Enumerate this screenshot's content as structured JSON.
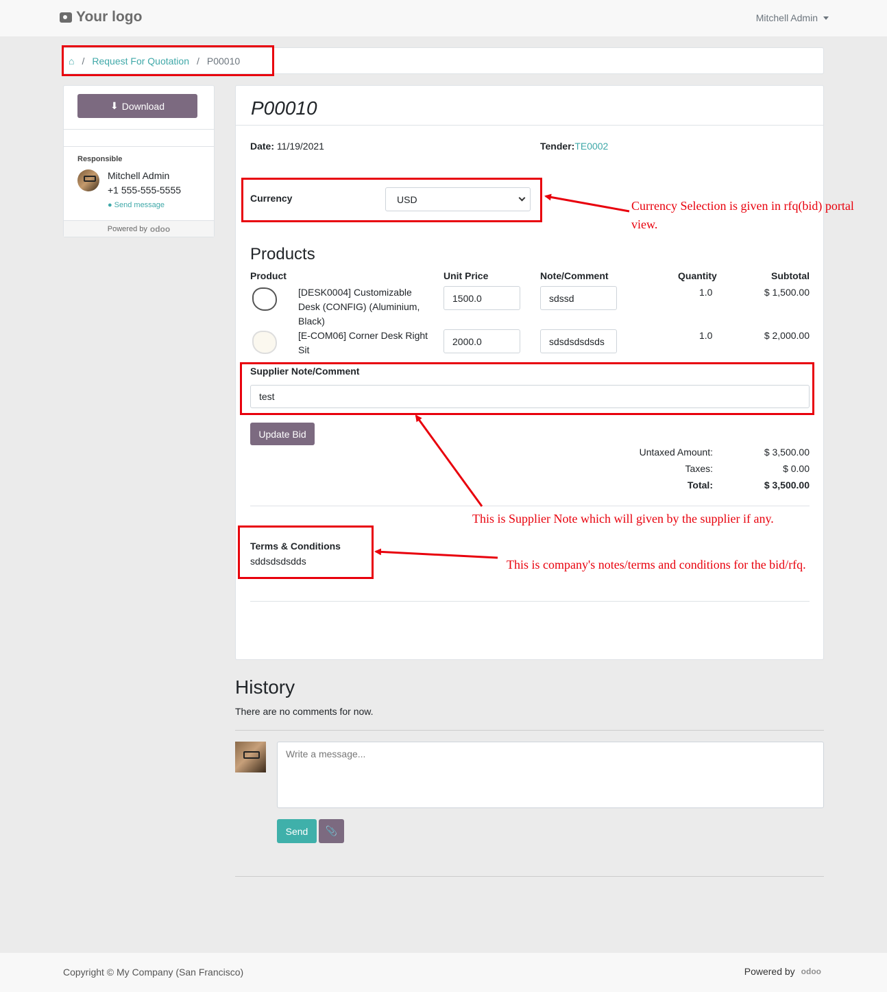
{
  "header": {
    "logo_text": "Your logo",
    "user_name": "Mitchell Admin"
  },
  "breadcrumb": {
    "link_label": "Request For Quotation",
    "current": "P00010"
  },
  "sidebar": {
    "download_label": "Download",
    "responsible_label": "Responsible",
    "responsible_name": "Mitchell Admin",
    "responsible_phone": "+1 555-555-5555",
    "send_message_label": "Send message",
    "powered_by": "Powered by",
    "odoo_brand": "odoo"
  },
  "rfq": {
    "title": "P00010",
    "date_label": "Date:",
    "date_value": "11/19/2021",
    "tender_label": "Tender:",
    "tender_value": "TE0002",
    "currency_label": "Currency",
    "currency_value": "USD",
    "products_heading": "Products",
    "columns": [
      "Product",
      "Unit Price",
      "Note/Comment",
      "Quantity",
      "Subtotal"
    ],
    "lines": [
      {
        "name": "[DESK0004] Customizable Desk (CONFIG) (Aluminium, Black)",
        "unit_price": "1500.0",
        "note": "sdssd",
        "quantity": "1.0",
        "subtotal": "$ 1,500.00"
      },
      {
        "name": "[E-COM06] Corner Desk Right Sit",
        "unit_price": "2000.0",
        "note": "sdsdsdsdsds",
        "quantity": "1.0",
        "subtotal": "$ 2,000.00"
      }
    ],
    "supplier_note_label": "Supplier Note/Comment",
    "supplier_note_value": "test",
    "update_bid_label": "Update Bid",
    "untaxed_label": "Untaxed Amount:",
    "untaxed_value": "$ 3,500.00",
    "taxes_label": "Taxes:",
    "taxes_value": "$ 0.00",
    "total_label": "Total:",
    "total_value": "$ 3,500.00",
    "terms_label": "Terms & Conditions",
    "terms_value": "sddsdsdsdds"
  },
  "history": {
    "heading": "History",
    "empty_text": "There are no comments for now.",
    "message_placeholder": "Write a message...",
    "send_label": "Send"
  },
  "footer": {
    "copyright": "Copyright © My Company (San Francisco)",
    "powered_by": "Powered by",
    "odoo_brand": "odoo"
  },
  "annotations": {
    "currency_note_line1": "Currency Selection is given in rfq(bid) portal",
    "currency_note_line2": "view.",
    "supplier_note_note": "This is Supplier Note which will given by the supplier if any.",
    "terms_note": "This is company's notes/terms and conditions for the bid/rfq."
  },
  "colors": {
    "brand_purple": "#7c6a80",
    "teal": "#3fa8a8",
    "annotation_red": "#e8000c"
  },
  "icons": [
    "camera-icon",
    "home-icon",
    "download-icon",
    "chat-icon",
    "paperclip-icon",
    "caret-down-icon"
  ]
}
